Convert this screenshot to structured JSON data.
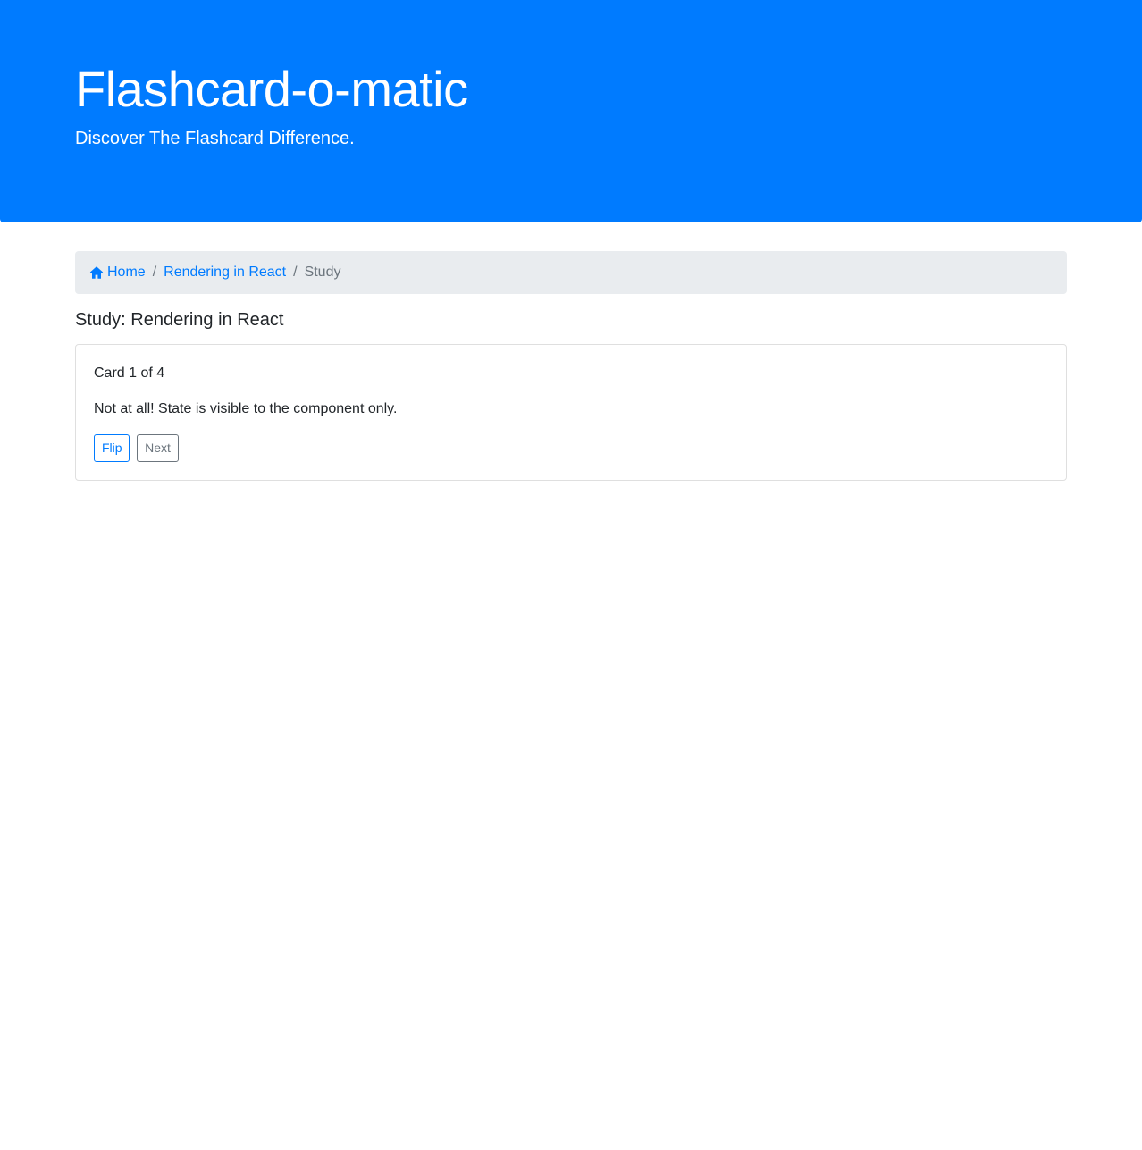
{
  "header": {
    "title": "Flashcard-o-matic",
    "subtitle": "Discover The Flashcard Difference."
  },
  "breadcrumb": {
    "home_icon": "home-icon",
    "home_label": "Home",
    "deck_label": "Rendering in React",
    "current_label": "Study",
    "separator": "/"
  },
  "main": {
    "title": "Study: Rendering in React"
  },
  "card": {
    "counter": "Card 1 of 4",
    "text": "Not at all! State is visible to the component only.",
    "flip_label": "Flip",
    "next_label": "Next"
  },
  "colors": {
    "primary": "#007bff",
    "secondary": "#6c757d",
    "breadcrumb_bg": "#e9ecef"
  }
}
